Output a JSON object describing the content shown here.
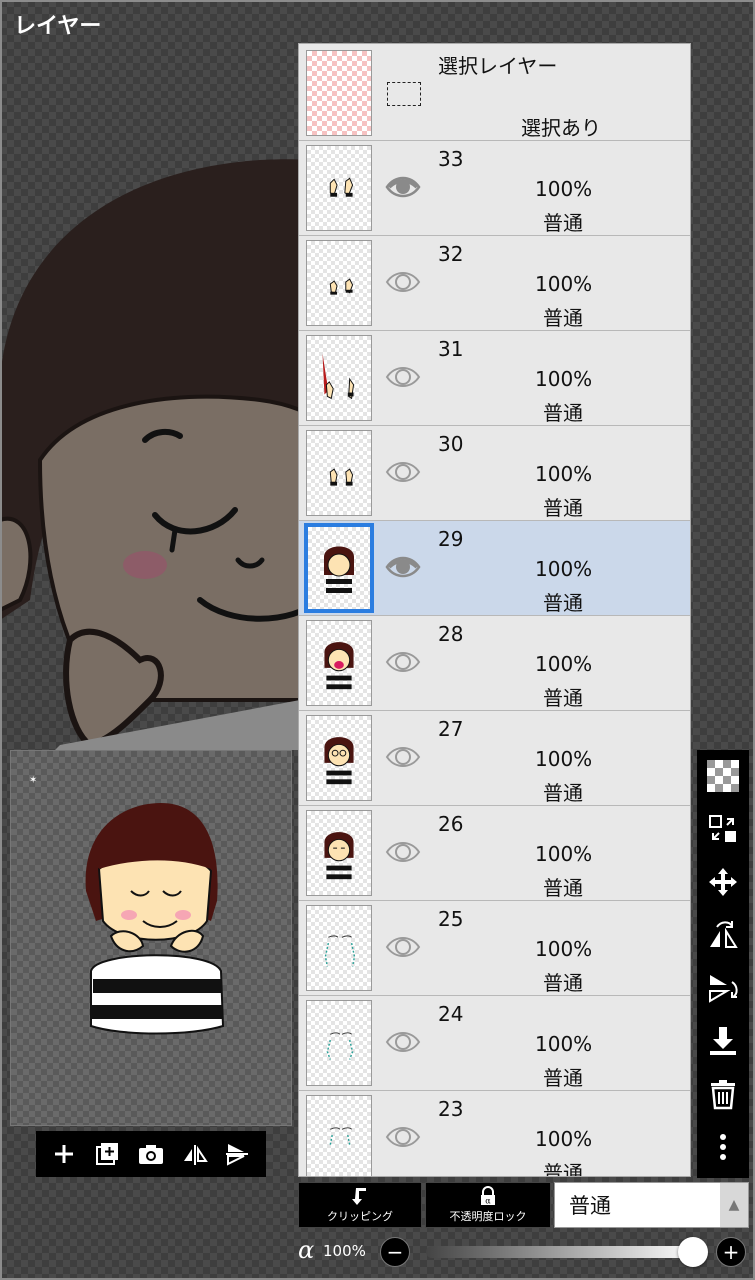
{
  "panel": {
    "title": "レイヤー"
  },
  "selection_layer": {
    "title": "選択レイヤー",
    "status": "選択あり"
  },
  "layers": [
    {
      "name": "33",
      "opacity": "100%",
      "mode": "普通",
      "visible": true,
      "selected": false
    },
    {
      "name": "32",
      "opacity": "100%",
      "mode": "普通",
      "visible": false,
      "selected": false
    },
    {
      "name": "31",
      "opacity": "100%",
      "mode": "普通",
      "visible": false,
      "selected": false
    },
    {
      "name": "30",
      "opacity": "100%",
      "mode": "普通",
      "visible": false,
      "selected": false
    },
    {
      "name": "29",
      "opacity": "100%",
      "mode": "普通",
      "visible": true,
      "selected": true
    },
    {
      "name": "28",
      "opacity": "100%",
      "mode": "普通",
      "visible": false,
      "selected": false
    },
    {
      "name": "27",
      "opacity": "100%",
      "mode": "普通",
      "visible": false,
      "selected": false
    },
    {
      "name": "26",
      "opacity": "100%",
      "mode": "普通",
      "visible": false,
      "selected": false
    },
    {
      "name": "25",
      "opacity": "100%",
      "mode": "普通",
      "visible": false,
      "selected": false
    },
    {
      "name": "24",
      "opacity": "100%",
      "mode": "普通",
      "visible": false,
      "selected": false
    },
    {
      "name": "23",
      "opacity": "100%",
      "mode": "普通",
      "visible": false,
      "selected": false
    }
  ],
  "buttons": {
    "clipping": "クリッピング",
    "alpha_lock": "不透明度ロック"
  },
  "blend_mode": {
    "value": "普通"
  },
  "opacity": {
    "symbol": "α",
    "value": "100%",
    "level": 1.0
  },
  "colors": {
    "selected_row": "#cbd8ea",
    "selected_border": "#2b7de0",
    "panel_bg": "#e8e8e8"
  }
}
